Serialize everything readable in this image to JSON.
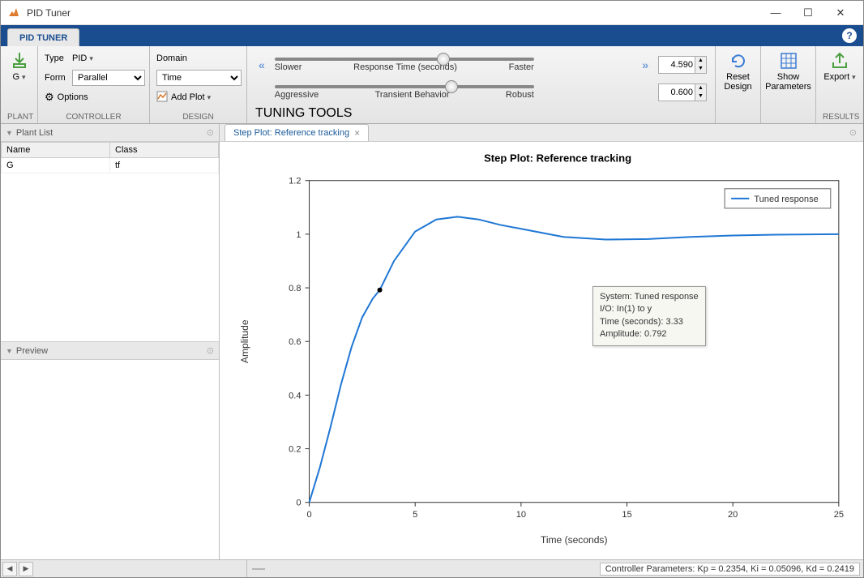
{
  "window": {
    "title": "PID Tuner"
  },
  "tab": {
    "label": "PID TUNER"
  },
  "ribbon": {
    "plant": {
      "btn": "G",
      "group": "PLANT"
    },
    "controller": {
      "type_label": "Type",
      "type_value": "PID",
      "form_label": "Form",
      "form_value": "Parallel",
      "options": "Options",
      "group": "CONTROLLER"
    },
    "design": {
      "domain_label": "Domain",
      "domain_value": "Time",
      "addplot": "Add Plot",
      "group": "DESIGN"
    },
    "tuning": {
      "rt_left": "Slower",
      "rt_mid": "Response Time (seconds)",
      "rt_right": "Faster",
      "rt_value": "4.590",
      "tb_left": "Aggressive",
      "tb_mid": "Transient Behavior",
      "tb_right": "Robust",
      "tb_value": "0.600",
      "group": "TUNING TOOLS"
    },
    "reset": {
      "label1": "Reset",
      "label2": "Design"
    },
    "show": {
      "label1": "Show",
      "label2": "Parameters"
    },
    "export": {
      "label": "Export"
    },
    "results_group": "RESULTS"
  },
  "left": {
    "plantlist": "Plant List",
    "col_name": "Name",
    "col_class": "Class",
    "row_name": "G",
    "row_class": "tf",
    "preview": "Preview"
  },
  "plot": {
    "tab": "Step Plot: Reference tracking",
    "title": "Step Plot: Reference tracking",
    "xlabel": "Time (seconds)",
    "ylabel": "Amplitude",
    "legend": "Tuned response",
    "xticks": [
      "0",
      "5",
      "10",
      "15",
      "20",
      "25"
    ],
    "yticks": [
      "0",
      "0.2",
      "0.4",
      "0.6",
      "0.8",
      "1",
      "1.2"
    ],
    "tip_l1": "System: Tuned response",
    "tip_l2": "I/O: In(1) to y",
    "tip_l3": "Time (seconds): 3.33",
    "tip_l4": "Amplitude: 0.792"
  },
  "chart_data": {
    "type": "line",
    "title": "Step Plot: Reference tracking",
    "xlabel": "Time (seconds)",
    "ylabel": "Amplitude",
    "xlim": [
      0,
      25
    ],
    "ylim": [
      0,
      1.2
    ],
    "grid": false,
    "legend": {
      "position": "upper-right",
      "entries": [
        "Tuned response"
      ]
    },
    "series": [
      {
        "name": "Tuned response",
        "x": [
          0,
          0.5,
          1,
          1.5,
          2,
          2.5,
          3,
          3.33,
          4,
          5,
          6,
          7,
          8,
          9,
          10,
          12,
          14,
          16,
          18,
          20,
          22,
          25
        ],
        "y": [
          0,
          0.13,
          0.28,
          0.44,
          0.58,
          0.69,
          0.76,
          0.792,
          0.9,
          1.01,
          1.055,
          1.065,
          1.055,
          1.035,
          1.02,
          0.99,
          0.98,
          0.982,
          0.99,
          0.995,
          0.998,
          1.0
        ]
      }
    ],
    "annotations": [
      {
        "type": "marker",
        "x": 3.33,
        "y": 0.792,
        "label": "Time 3.33, Amplitude 0.792"
      }
    ]
  },
  "status": "Controller Parameters: Kp = 0.2354, Ki = 0.05096, Kd = 0.2419"
}
